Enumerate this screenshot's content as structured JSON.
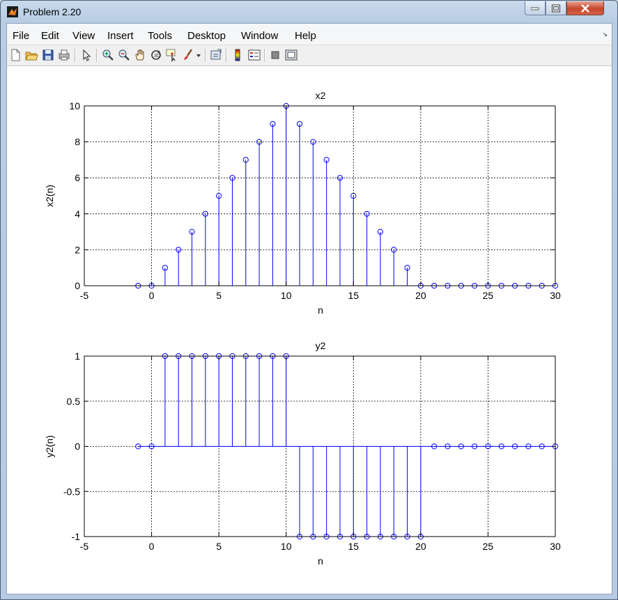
{
  "window": {
    "title": "Problem 2.20"
  },
  "menu": {
    "items": [
      "File",
      "Edit",
      "View",
      "Insert",
      "Tools",
      "Desktop",
      "Window",
      "Help"
    ]
  },
  "toolbar": {
    "icons": [
      "new-figure-icon",
      "open-file-icon",
      "save-icon",
      "print-icon",
      "edit-plot-arrow-icon",
      "zoom-in-icon",
      "zoom-out-icon",
      "pan-hand-icon",
      "rotate-3d-icon",
      "data-cursor-icon",
      "brush-icon",
      "brush-dropdown-icon",
      "link-plot-icon",
      "insert-colorbar-icon",
      "insert-legend-icon",
      "hide-plot-tools-icon",
      "show-plot-tools-icon"
    ]
  },
  "colors": {
    "stem": "#0000ff",
    "grid": "#000000",
    "background": "#ffffff"
  },
  "chart_data": [
    {
      "type": "stem",
      "title": "x2",
      "xlabel": "n",
      "ylabel": "x2(n)",
      "xlim": [
        -5,
        30
      ],
      "ylim": [
        0,
        10
      ],
      "xticks": [
        -5,
        0,
        5,
        10,
        15,
        20,
        25,
        30
      ],
      "yticks": [
        0,
        2,
        4,
        6,
        8,
        10
      ],
      "xtick_labels": [
        "-5",
        "0",
        "5",
        "10",
        "15",
        "20",
        "25",
        "30"
      ],
      "ytick_labels": [
        "0",
        "2",
        "4",
        "6",
        "8",
        "10"
      ],
      "grid": true,
      "x": [
        -1,
        0,
        1,
        2,
        3,
        4,
        5,
        6,
        7,
        8,
        9,
        10,
        11,
        12,
        13,
        14,
        15,
        16,
        17,
        18,
        19,
        20,
        21,
        22,
        23,
        24,
        25,
        26,
        27,
        28,
        29,
        30
      ],
      "y": [
        0,
        0,
        1,
        2,
        3,
        4,
        5,
        6,
        7,
        8,
        9,
        10,
        9,
        8,
        7,
        6,
        5,
        4,
        3,
        2,
        1,
        0,
        0,
        0,
        0,
        0,
        0,
        0,
        0,
        0,
        0,
        0
      ]
    },
    {
      "type": "stem",
      "title": "y2",
      "xlabel": "n",
      "ylabel": "y2(n)",
      "xlim": [
        -5,
        30
      ],
      "ylim": [
        -1,
        1
      ],
      "xticks": [
        -5,
        0,
        5,
        10,
        15,
        20,
        25,
        30
      ],
      "yticks": [
        -1,
        -0.5,
        0,
        0.5,
        1
      ],
      "xtick_labels": [
        "-5",
        "0",
        "5",
        "10",
        "15",
        "20",
        "25",
        "30"
      ],
      "ytick_labels": [
        "-1",
        "-0.5",
        "0",
        "0.5",
        "1"
      ],
      "grid": true,
      "x": [
        -1,
        0,
        1,
        2,
        3,
        4,
        5,
        6,
        7,
        8,
        9,
        10,
        11,
        12,
        13,
        14,
        15,
        16,
        17,
        18,
        19,
        20,
        21,
        22,
        23,
        24,
        25,
        26,
        27,
        28,
        29,
        30
      ],
      "y": [
        0,
        0,
        1,
        1,
        1,
        1,
        1,
        1,
        1,
        1,
        1,
        1,
        -1,
        -1,
        -1,
        -1,
        -1,
        -1,
        -1,
        -1,
        -1,
        -1,
        0,
        0,
        0,
        0,
        0,
        0,
        0,
        0,
        0,
        0
      ]
    }
  ]
}
